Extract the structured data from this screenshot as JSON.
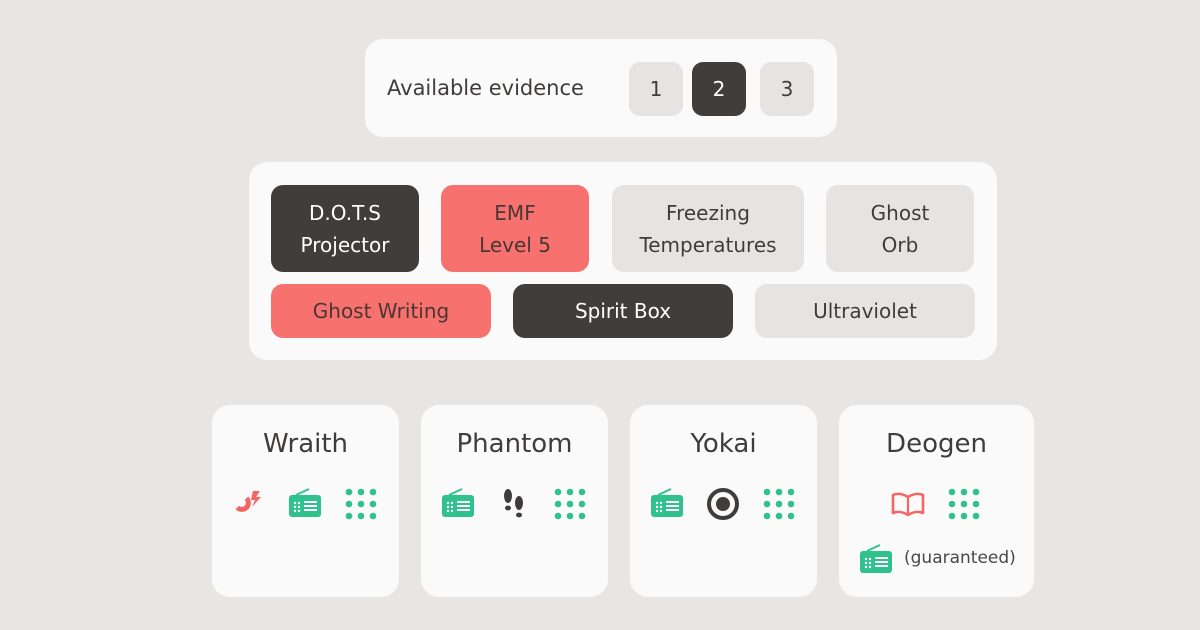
{
  "evidence_count": {
    "label": "Available evidence",
    "options": [
      "1",
      "2",
      "3"
    ],
    "selected": "2"
  },
  "evidence": [
    {
      "label": "D.O.T.S\nProjector",
      "state": "selected"
    },
    {
      "label": "EMF\nLevel 5",
      "state": "excluded"
    },
    {
      "label": "Freezing\nTemperatures",
      "state": "neutral"
    },
    {
      "label": "Ghost\nOrb",
      "state": "neutral"
    },
    {
      "label": "Ghost Writing",
      "state": "excluded"
    },
    {
      "label": "Spirit Box",
      "state": "selected"
    },
    {
      "label": "Ultraviolet",
      "state": "neutral"
    }
  ],
  "ghosts": [
    {
      "name": "Wraith",
      "evidence_icons": [
        "emf-icon",
        "spirit-box-icon",
        "dots-icon"
      ]
    },
    {
      "name": "Phantom",
      "evidence_icons": [
        "spirit-box-icon",
        "footprints-icon",
        "dots-icon"
      ]
    },
    {
      "name": "Yokai",
      "evidence_icons": [
        "spirit-box-icon",
        "ghost-orb-icon",
        "dots-icon"
      ]
    },
    {
      "name": "Deogen",
      "evidence_icons": [
        "ghost-writing-icon",
        "dots-icon"
      ],
      "guaranteed_icon": "spirit-box-icon",
      "guaranteed_label": "(guaranteed)"
    }
  ],
  "colors": {
    "selected": "#413d3a",
    "excluded": "#f7716f",
    "neutral": "#e6e4e2",
    "icon_green": "#2fc28c",
    "icon_red": "#f46663",
    "background": "#e8e6e4"
  }
}
